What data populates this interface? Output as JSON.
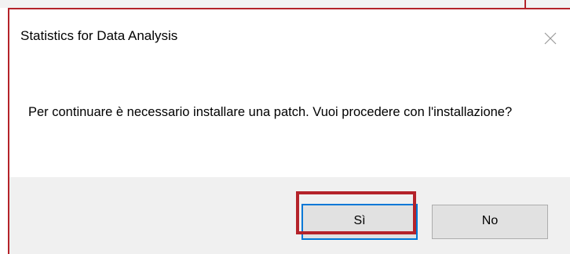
{
  "dialog": {
    "title": "Statistics for Data Analysis",
    "message": "Per continuare è necessario installare una patch. Vuoi procedere con l'installazione?",
    "buttons": {
      "yes_label": "Sì",
      "no_label": "No"
    },
    "close_icon": "close-icon"
  },
  "colors": {
    "highlight": "#b4232a",
    "button_area": "#f0f0f0",
    "button_face": "#e1e1e1",
    "focus_border": "#0078d7"
  }
}
